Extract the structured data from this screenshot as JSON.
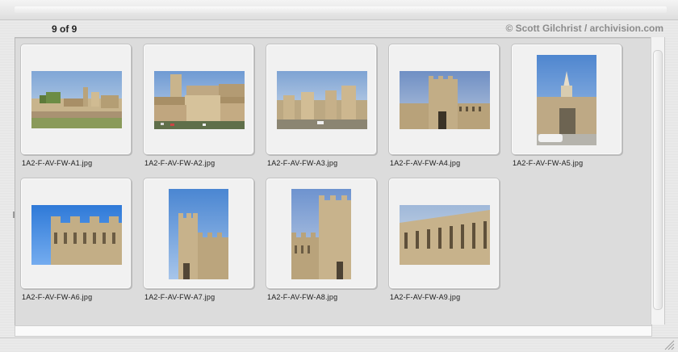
{
  "header": {
    "count": "9 of 9",
    "credit": "© Scott Gilchrist / archivision.com"
  },
  "gallery": {
    "items": [
      {
        "filename": "1A2-F-AV-FW-A1.jpg",
        "thumb_icon": "avignon-cityscape-photo"
      },
      {
        "filename": "1A2-F-AV-FW-A2.jpg",
        "thumb_icon": "avignon-ramparts-palace-photo"
      },
      {
        "filename": "1A2-F-AV-FW-A3.jpg",
        "thumb_icon": "avignon-wall-towers-photo"
      },
      {
        "filename": "1A2-F-AV-FW-A4.jpg",
        "thumb_icon": "avignon-gate-tower-photo"
      },
      {
        "filename": "1A2-F-AV-FW-A5.jpg",
        "thumb_icon": "avignon-gate-steeple-photo"
      },
      {
        "filename": "1A2-F-AV-FW-A6.jpg",
        "thumb_icon": "crenellated-tower-photo"
      },
      {
        "filename": "1A2-F-AV-FW-A7.jpg",
        "thumb_icon": "corner-tower-photo"
      },
      {
        "filename": "1A2-F-AV-FW-A8.jpg",
        "thumb_icon": "tower-wall-photo"
      },
      {
        "filename": "1A2-F-AV-FW-A9.jpg",
        "thumb_icon": "machicolated-wall-photo"
      }
    ]
  },
  "colors": {
    "sky": "#7da6d8",
    "stone": "#c9b48e",
    "panel_bg": "#dcdcdc",
    "card_bg": "#f1f1f1",
    "credit_text": "#8b8b8b"
  }
}
